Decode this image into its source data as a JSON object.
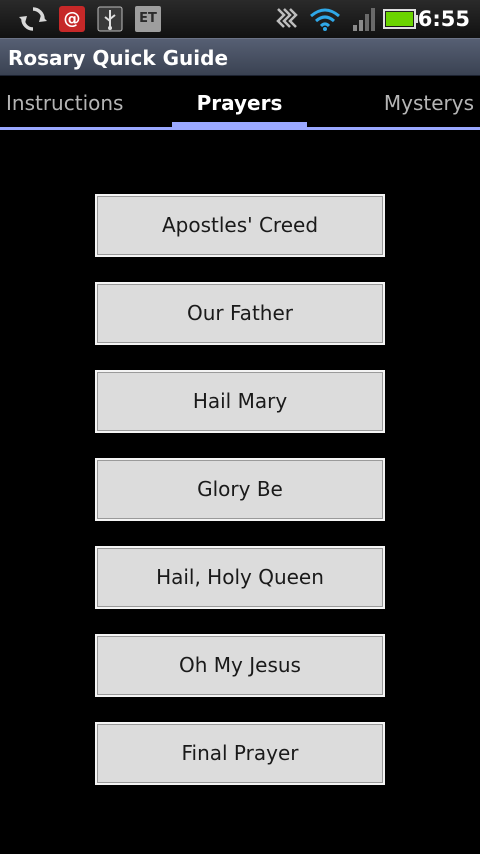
{
  "status_bar": {
    "time": "6:55",
    "notification_badge": "@",
    "app_badge": "ET",
    "icons": [
      "sync-icon",
      "email-icon",
      "usb-icon",
      "et-app-icon",
      "vibrate-icon",
      "wifi-icon",
      "signal-icon",
      "battery-icon"
    ],
    "battery_color": "#6bd400"
  },
  "app": {
    "title": "Rosary Quick Guide"
  },
  "tabs": [
    {
      "label": "Instructions",
      "selected": false
    },
    {
      "label": "Prayers",
      "selected": true
    },
    {
      "label": "Mysterys",
      "selected": false
    }
  ],
  "accent_color": "#9aa8ff",
  "prayers": [
    {
      "label": "Apostles' Creed"
    },
    {
      "label": "Our Father"
    },
    {
      "label": "Hail Mary"
    },
    {
      "label": "Glory Be"
    },
    {
      "label": "Hail, Holy Queen"
    },
    {
      "label": "Oh My Jesus"
    },
    {
      "label": "Final Prayer"
    }
  ]
}
